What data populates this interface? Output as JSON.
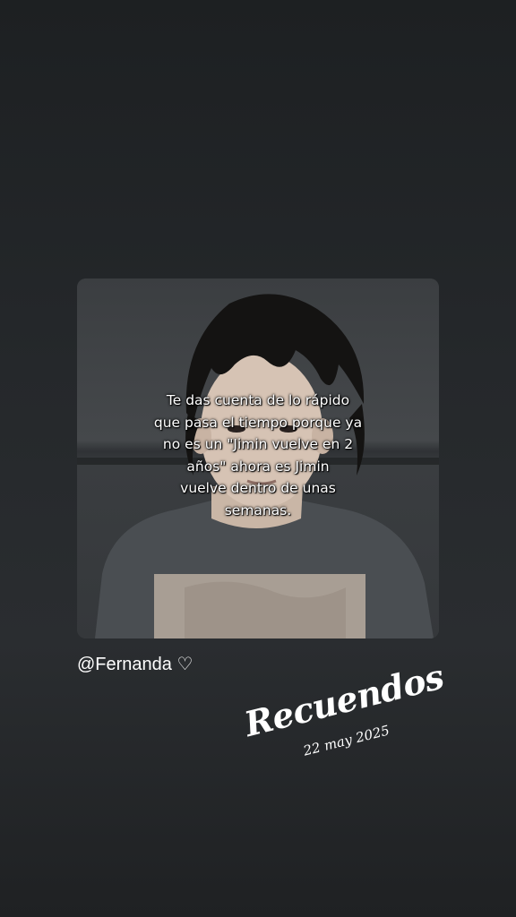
{
  "story": {
    "media": {
      "caption": "Te das cuenta de lo rápido\nque pasa el tiempo porque ya\nno es un \"Jimin vuelve en 2\naños\" ahora es Jimin\nvuelve dentro de unas\nsemanas."
    },
    "mention": "@Fernanda ♡",
    "sticker": {
      "title": "Recuendos",
      "date": "22 may 2025"
    }
  }
}
